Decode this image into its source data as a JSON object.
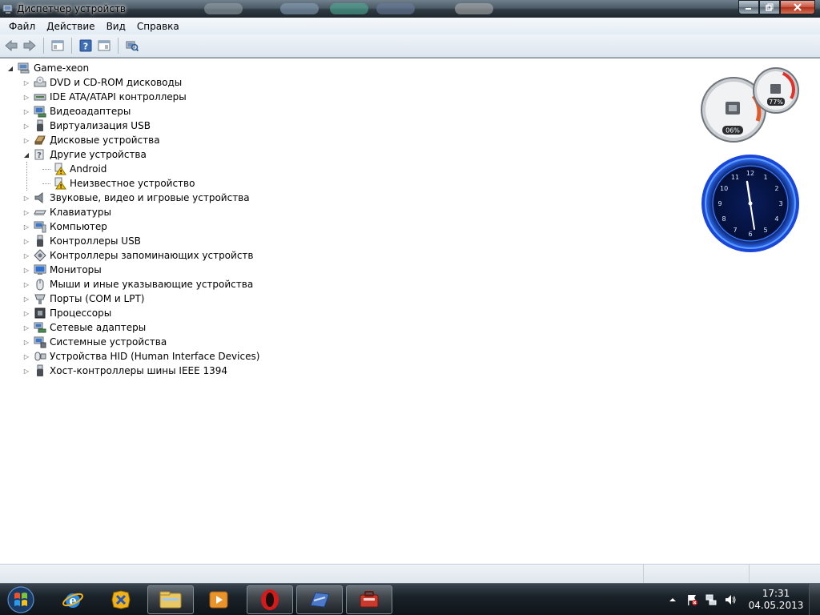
{
  "window": {
    "title": "Диспетчер устройств"
  },
  "menu": [
    "Файл",
    "Действие",
    "Вид",
    "Справка"
  ],
  "tree": {
    "root": "Game-xeon",
    "items": [
      {
        "label": "DVD и CD-ROM дисководы",
        "icon": "dvd-drive-icon",
        "expanded": false
      },
      {
        "label": "IDE ATA/ATAPI контроллеры",
        "icon": "ide-controller-icon",
        "expanded": false
      },
      {
        "label": "Видеоадаптеры",
        "icon": "display-adapter-icon",
        "expanded": false
      },
      {
        "label": "Виртуализация USB",
        "icon": "usb-icon",
        "expanded": false
      },
      {
        "label": "Дисковые устройства",
        "icon": "disk-drive-icon",
        "expanded": false
      },
      {
        "label": "Другие устройства",
        "icon": "other-devices-icon",
        "expanded": true,
        "children": [
          {
            "label": "Android",
            "icon": "unknown-device-warning-icon"
          },
          {
            "label": "Неизвестное устройство",
            "icon": "unknown-device-warning-icon"
          }
        ]
      },
      {
        "label": "Звуковые, видео и игровые устройства",
        "icon": "speaker-icon",
        "expanded": false
      },
      {
        "label": "Клавиатуры",
        "icon": "keyboard-icon",
        "expanded": false
      },
      {
        "label": "Компьютер",
        "icon": "computer-icon",
        "expanded": false
      },
      {
        "label": "Контроллеры USB",
        "icon": "usb-icon",
        "expanded": false
      },
      {
        "label": "Контроллеры запоминающих устройств",
        "icon": "storage-controller-icon",
        "expanded": false
      },
      {
        "label": "Мониторы",
        "icon": "monitor-icon",
        "expanded": false
      },
      {
        "label": "Мыши и иные указывающие устройства",
        "icon": "mouse-icon",
        "expanded": false
      },
      {
        "label": "Порты (COM и LPT)",
        "icon": "port-icon",
        "expanded": false
      },
      {
        "label": "Процессоры",
        "icon": "processor-icon",
        "expanded": false
      },
      {
        "label": "Сетевые адаптеры",
        "icon": "network-adapter-icon",
        "expanded": false
      },
      {
        "label": "Системные устройства",
        "icon": "system-device-icon",
        "expanded": false
      },
      {
        "label": "Устройства HID (Human Interface Devices)",
        "icon": "hid-icon",
        "expanded": false
      },
      {
        "label": "Хост-контроллеры шины IEEE 1394",
        "icon": "ieee1394-icon",
        "expanded": false
      }
    ]
  },
  "gadgets": {
    "cpu_meter": {
      "cpu_value": "06%",
      "ram_value": "77%"
    },
    "clock_numbers": [
      "12",
      "1",
      "2",
      "3",
      "4",
      "5",
      "6",
      "7",
      "8",
      "9",
      "10",
      "11"
    ]
  },
  "taskbar": {
    "clock_time": "17:31",
    "clock_date": "04.05.2013"
  },
  "colors": {
    "accent": "#2f6fcf",
    "warning": "#f2c200",
    "clock_glow": "#2d6cff"
  }
}
